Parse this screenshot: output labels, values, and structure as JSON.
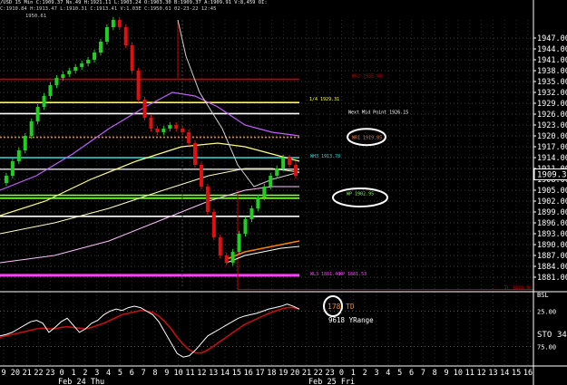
{
  "header": {
    "line1": "/USD 15 Min C:1909.37 Ns.49 H:1921.11 L:1903.24 O:1903.30 B:1909.37 A:1909.91 V:8,459 OI:",
    "line2": "C:1910.84 H:1913.47 L:1910.31 C:1913.41 V:1.03E C:1950.61 02-23-22 12:45",
    "line3": "1950.61"
  },
  "chart_data": {
    "type": "candlestick",
    "symbol": "/USD",
    "interval": "15 Min",
    "ylim": [
      1878,
      1952
    ],
    "y_ticks": [
      "1947.00",
      "1944.00",
      "1941.00",
      "1938.00",
      "1935.00",
      "1932.00",
      "1929.00",
      "1926.00",
      "1923.00",
      "1920.00",
      "1917.00",
      "1914.00",
      "1911.00",
      "1908.00",
      "1905.00",
      "1902.00",
      "1899.00",
      "1896.00",
      "1893.00",
      "1890.00",
      "1887.00",
      "1884.00",
      "1881.00"
    ],
    "last_price": "1909.37",
    "x_ticks": [
      "9",
      "20",
      "21",
      "22",
      "23",
      "0",
      "1",
      "2",
      "3",
      "4",
      "5",
      "6",
      "7",
      "8",
      "9",
      "10",
      "11",
      "12",
      "13",
      "14",
      "15",
      "16",
      "17",
      "18",
      "19",
      "20",
      "21",
      "22",
      "23",
      "0",
      "1",
      "2",
      "3",
      "4",
      "5",
      "6",
      "7",
      "8",
      "9",
      "10",
      "11",
      "12",
      "13",
      "14",
      "15",
      "16"
    ],
    "date_labels": [
      "Feb 24 Thu",
      "Feb 25 Fri"
    ],
    "price_path": [
      1907,
      1909,
      1913,
      1916,
      1920,
      1924,
      1928,
      1931,
      1934,
      1936,
      1937,
      1938,
      1939,
      1940,
      1941,
      1943,
      1946,
      1950,
      1952,
      1950,
      1945,
      1938,
      1930,
      1925,
      1922,
      1921,
      1922,
      1923,
      1922,
      1921,
      1918,
      1912,
      1906,
      1899,
      1892,
      1887,
      1885,
      1888,
      1893,
      1897,
      1900,
      1903,
      1906,
      1909,
      1911,
      1914,
      1912,
      1909
    ],
    "levels": [
      {
        "price": 1935.6,
        "color": "#c80000",
        "label": "WR2 1935.40"
      },
      {
        "price": 1929.2,
        "color": "#ffff40",
        "label": "1/4 1929.31"
      },
      {
        "price": 1926.15,
        "color": "#ffffff",
        "label": "Next Mid Point 1926.15"
      },
      {
        "price": 1919.6,
        "color": "#ff7820",
        "label": "WR1 1919.85"
      },
      {
        "price": 1914.0,
        "color": "#28e0d8",
        "label": "WH3 1913.78"
      },
      {
        "price": 1910.8,
        "color": "#c0c0c0",
        "label": ""
      },
      {
        "price": 1903.6,
        "color": "#80ff40",
        "label": "WP 1902.95"
      },
      {
        "price": 1902.8,
        "color": "#80ff40",
        "label": ""
      },
      {
        "price": 1897.8,
        "color": "#ffffff",
        "label": ""
      },
      {
        "price": 1881.5,
        "color": "#ff40ff",
        "label": "WL3 1881.40"
      },
      {
        "price": 1881.5,
        "color": "#ff40ff",
        "label": "WP 1881.53"
      },
      {
        "price": 1877.6,
        "color": "#c80000",
        "label": "TL 1878.90"
      }
    ],
    "indicator": {
      "name": "STO",
      "value": "34",
      "td_count": "178",
      "td_label": "TD",
      "range_text": "9618 YRange",
      "top_label": "BSL",
      "levels": [
        "25.00",
        "75.00"
      ],
      "k_path": [
        60,
        58,
        55,
        50,
        45,
        40,
        38,
        42,
        55,
        48,
        40,
        35,
        45,
        55,
        50,
        42,
        38,
        30,
        25,
        22,
        24,
        20,
        18,
        20,
        25,
        30,
        40,
        55,
        70,
        85,
        90,
        88,
        80,
        70,
        60,
        55,
        50,
        45,
        40,
        35,
        32,
        30,
        28,
        25,
        22,
        20,
        18,
        15,
        18,
        22
      ],
      "d_path": [
        62,
        60,
        58,
        56,
        54,
        52,
        50,
        49,
        50,
        50,
        48,
        47,
        48,
        49,
        50,
        48,
        45,
        42,
        38,
        34,
        30,
        28,
        26,
        24,
        25,
        27,
        32,
        40,
        50,
        62,
        72,
        80,
        84,
        84,
        80,
        74,
        68,
        62,
        56,
        50,
        44,
        40,
        36,
        32,
        28,
        25,
        22,
        20,
        20,
        22
      ]
    }
  }
}
